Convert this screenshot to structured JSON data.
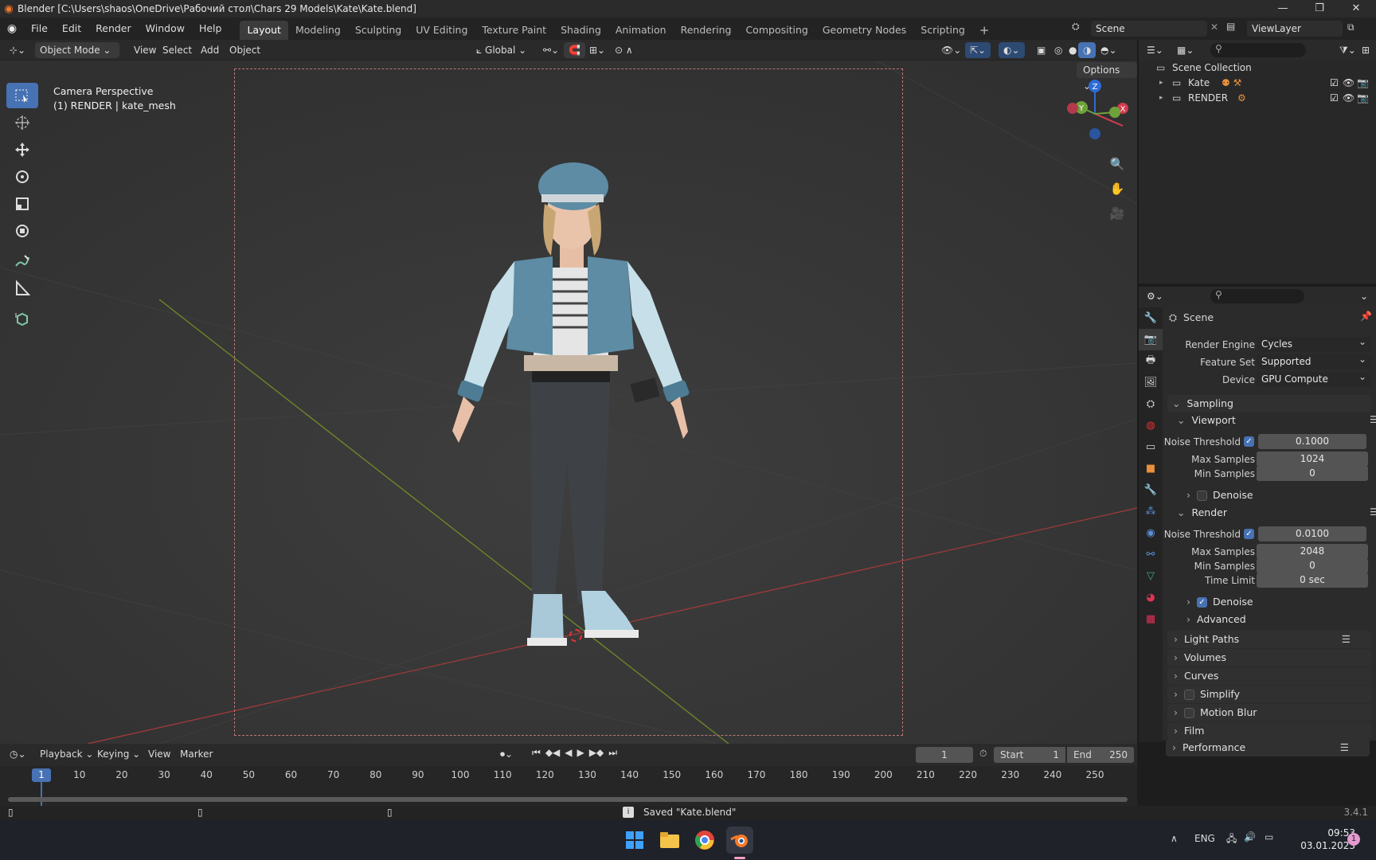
{
  "titlebar": {
    "title": "Blender [C:\\Users\\shaos\\OneDrive\\Рабочий стол\\Chars 29 Models\\Kate\\Kate.blend]"
  },
  "menu": {
    "items": [
      "File",
      "Edit",
      "Render",
      "Window",
      "Help"
    ]
  },
  "workspaces": [
    "Layout",
    "Modeling",
    "Sculpting",
    "UV Editing",
    "Texture Paint",
    "Shading",
    "Animation",
    "Rendering",
    "Compositing",
    "Geometry Nodes",
    "Scripting"
  ],
  "scene_name": "Scene",
  "view_layer": "ViewLayer",
  "viewport": {
    "mode": "Object Mode",
    "menus": [
      "View",
      "Select",
      "Add",
      "Object"
    ],
    "orientation": "Global",
    "options": "Options",
    "info_line1": "Camera Perspective",
    "info_line2": "(1) RENDER | kate_mesh",
    "gizmo": {
      "z": "Z",
      "y": "Y",
      "x": "X"
    }
  },
  "outliner": {
    "root": "Scene Collection",
    "collections": [
      "Kate",
      "RENDER"
    ]
  },
  "properties": {
    "context": "Scene",
    "render_engine_label": "Render Engine",
    "render_engine": "Cycles",
    "feature_set_label": "Feature Set",
    "feature_set": "Supported",
    "device_label": "Device",
    "device": "GPU Compute",
    "sampling": "Sampling",
    "viewport_sub": "Viewport",
    "noise_threshold_label": "Noise Threshold",
    "viewport_noise_threshold": "0.1000",
    "max_samples_label": "Max Samples",
    "viewport_max_samples": "1024",
    "min_samples_label": "Min Samples",
    "viewport_min_samples": "0",
    "denoise_label": "Denoise",
    "render_sub": "Render",
    "render_noise_threshold": "0.0100",
    "render_max_samples": "2048",
    "render_min_samples": "0",
    "time_limit_label": "Time Limit",
    "time_limit": "0 sec",
    "advanced": "Advanced",
    "panels": [
      "Light Paths",
      "Volumes",
      "Curves",
      "Simplify",
      "Motion Blur",
      "Film",
      "Performance"
    ]
  },
  "timeline": {
    "menus": [
      "Playback",
      "Keying",
      "View",
      "Marker"
    ],
    "current_frame": "1",
    "start_label": "Start",
    "start": "1",
    "end_label": "End",
    "end": "250",
    "ticks": [
      "1",
      "10",
      "20",
      "30",
      "40",
      "50",
      "60",
      "70",
      "80",
      "90",
      "100",
      "110",
      "120",
      "130",
      "140",
      "150",
      "160",
      "170",
      "180",
      "190",
      "200",
      "210",
      "220",
      "230",
      "240",
      "250"
    ]
  },
  "status": {
    "message": "Saved \"Kate.blend\"",
    "version": "3.4.1"
  },
  "taskbar": {
    "lang": "ENG",
    "time": "09:53",
    "date": "03.01.2023",
    "notifications": "1"
  }
}
